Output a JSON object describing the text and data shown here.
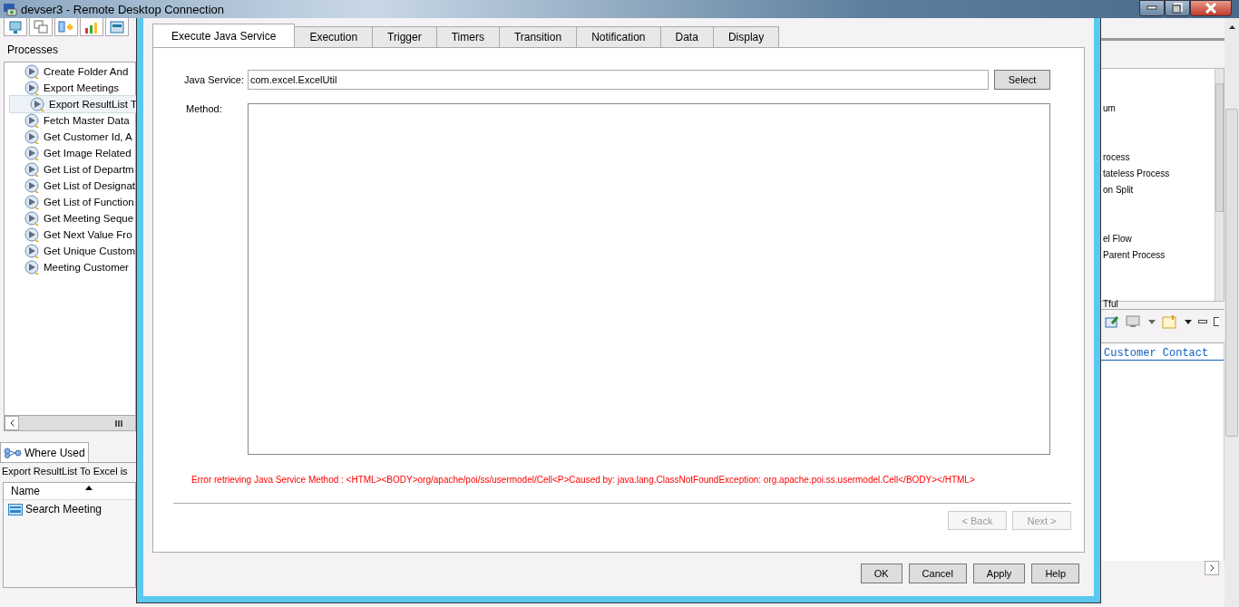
{
  "window": {
    "title": "devser3 - Remote Desktop Connection"
  },
  "processes_panel": {
    "title": "Processes",
    "items": [
      {
        "label": "Create Folder And",
        "selected": false
      },
      {
        "label": "Export Meetings",
        "selected": false
      },
      {
        "label": "Export ResultList T",
        "selected": true
      },
      {
        "label": "Fetch Master Data",
        "selected": false
      },
      {
        "label": "Get Customer  Id, A",
        "selected": false
      },
      {
        "label": "Get Image Related",
        "selected": false
      },
      {
        "label": "Get List of Departm",
        "selected": false
      },
      {
        "label": "Get List of Designat",
        "selected": false
      },
      {
        "label": "Get List of Function",
        "selected": false
      },
      {
        "label": "Get Meeting Seque",
        "selected": false
      },
      {
        "label": "Get Next Value Fro",
        "selected": false
      },
      {
        "label": "Get Unique Custom",
        "selected": false
      },
      {
        "label": "Meeting Customer",
        "selected": false
      }
    ]
  },
  "where_used": {
    "tab": "Where Used",
    "caption": "Export ResultList To Excel is",
    "column": "Name",
    "rows": [
      "Search Meeting"
    ]
  },
  "right_panel": {
    "items": [
      "um",
      "rocess",
      "tateless Process",
      "on Split",
      "el Flow",
      "Parent Process",
      "Tful"
    ],
    "editor_text": "Customer Contact"
  },
  "dialog": {
    "tabs": [
      {
        "label": "Execute Java Service",
        "selected": true
      },
      {
        "label": "Execution",
        "selected": false
      },
      {
        "label": "Trigger",
        "selected": false
      },
      {
        "label": "Timers",
        "selected": false
      },
      {
        "label": "Transition",
        "selected": false
      },
      {
        "label": "Notification",
        "selected": false
      },
      {
        "label": "Data",
        "selected": false
      },
      {
        "label": "Display",
        "selected": false
      }
    ],
    "java_service": {
      "label": "Java Service:",
      "value": "com.excel.ExcelUtil"
    },
    "select_button": "Select",
    "method": {
      "label": "Method:"
    },
    "error": "Error retrieving Java Service Method : <HTML><BODY>org/apache/poi/ss/usermodel/Cell<P>Caused by: java.lang.ClassNotFoundException: org.apache.poi.ss.usermodel.Cell</BODY></HTML>",
    "nav_buttons": [
      {
        "label": "< Back",
        "disabled": true
      },
      {
        "label": "Next >",
        "disabled": true
      }
    ],
    "buttons": [
      "OK",
      "Cancel",
      "Apply",
      "Help"
    ]
  }
}
